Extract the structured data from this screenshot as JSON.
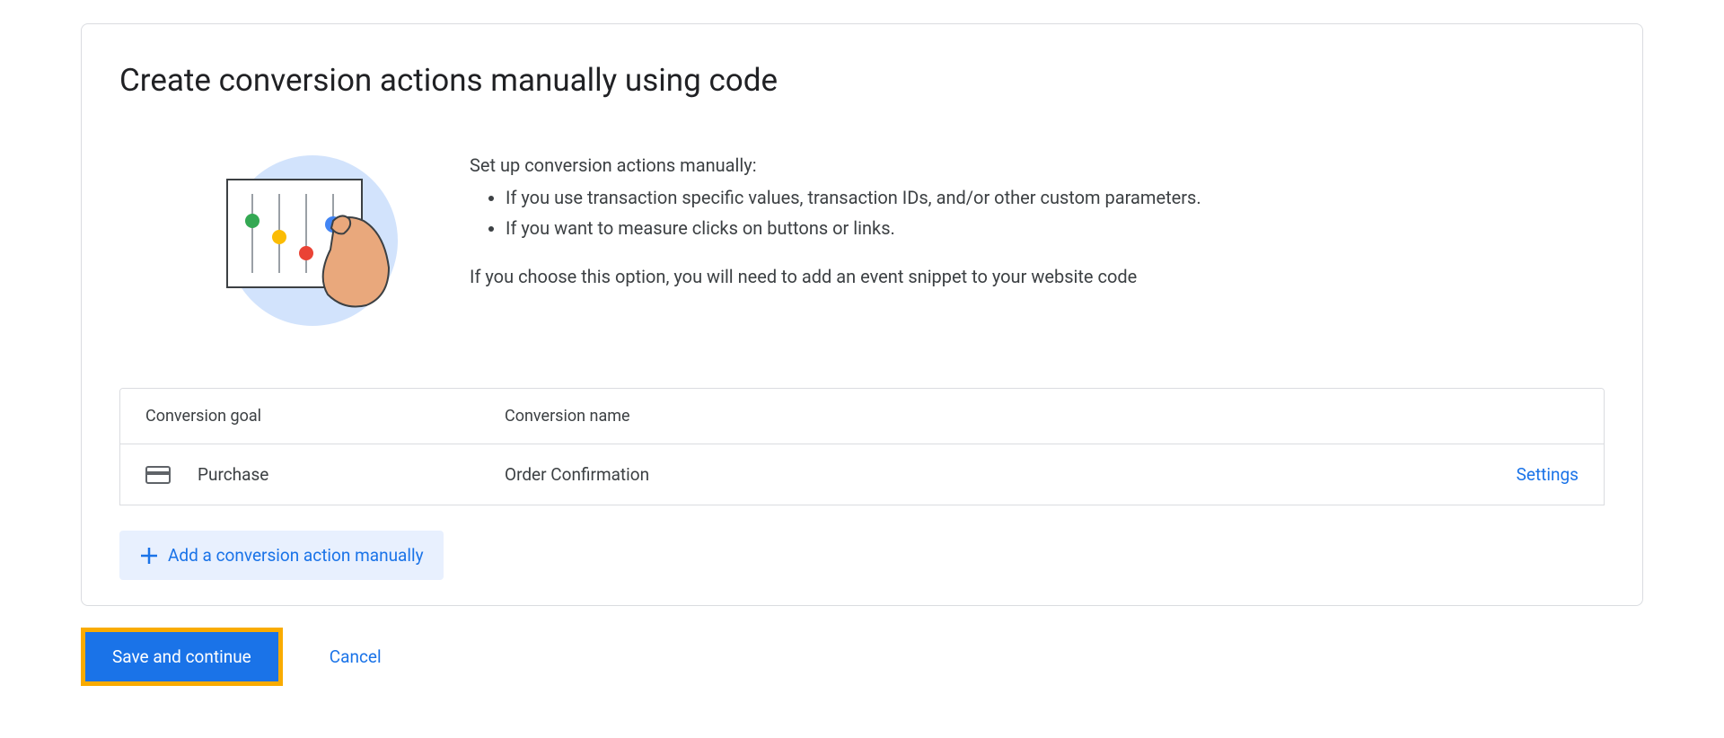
{
  "card": {
    "title": "Create conversion actions manually using code",
    "intro": "Set up conversion actions manually:",
    "bullets": [
      "If you use transaction specific values, transaction IDs, and/or other custom parameters.",
      "If you want to measure clicks on buttons or links."
    ],
    "note": "If you choose this option, you will need to add an event snippet to your website code"
  },
  "table": {
    "headers": {
      "goal": "Conversion goal",
      "name": "Conversion name"
    },
    "rows": [
      {
        "goal": "Purchase",
        "name": "Order Confirmation",
        "action": "Settings"
      }
    ]
  },
  "actions": {
    "add": "Add a conversion action manually",
    "save": "Save and continue",
    "cancel": "Cancel"
  }
}
